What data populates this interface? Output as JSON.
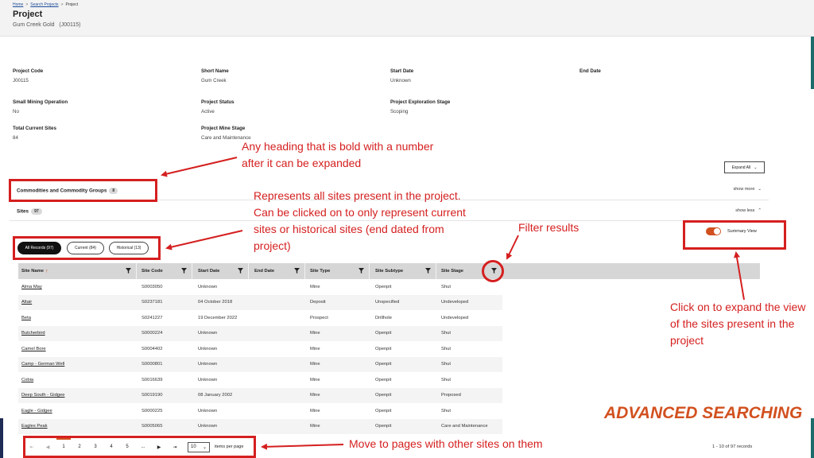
{
  "breadcrumb": {
    "home": "Home",
    "search": "Search Projects",
    "current": "Project"
  },
  "header": {
    "title": "Project",
    "subtitle": "Gum Creek Gold",
    "code": "(J00115)"
  },
  "fields": {
    "project_code": {
      "label": "Project Code",
      "value": "J00115"
    },
    "short_name": {
      "label": "Short Name",
      "value": "Gum Creek"
    },
    "start_date": {
      "label": "Start Date",
      "value": "Unknown"
    },
    "end_date": {
      "label": "End Date",
      "value": ""
    },
    "small_mining": {
      "label": "Small Mining Operation",
      "value": "No"
    },
    "project_status": {
      "label": "Project Status",
      "value": "Active"
    },
    "exploration_stage": {
      "label": "Project Exploration Stage",
      "value": "Scoping"
    },
    "total_sites": {
      "label": "Total Current Sites",
      "value": "84"
    },
    "mine_stage": {
      "label": "Project Mine Stage",
      "value": "Care and Maintenance"
    }
  },
  "expand_all": "Expand All",
  "commodities": {
    "title": "Commodities and Commodity Groups",
    "count": "8",
    "toggle": "show more"
  },
  "sites": {
    "title": "Sites",
    "count": "97",
    "toggle": "show less"
  },
  "filters": {
    "all": "All Records (97)",
    "current": "Current (84)",
    "historical": "Historical (13)"
  },
  "summary_view": "Summary View",
  "table": {
    "columns": [
      "Site Name",
      "Site Code",
      "Start Date",
      "End Date",
      "Site Type",
      "Site Subtype",
      "Site Stage"
    ],
    "rows": [
      [
        "Alma May",
        "S0003050",
        "Unknown",
        "",
        "Mine",
        "Openpit",
        "Shut"
      ],
      [
        "Altair",
        "S0237181",
        "04 October 2018",
        "",
        "Deposit",
        "Unspecified",
        "Undeveloped"
      ],
      [
        "Beta",
        "S0241227",
        "19 December 2022",
        "",
        "Prospect",
        "Drillhole",
        "Undeveloped"
      ],
      [
        "Butcherbird",
        "S0000224",
        "Unknown",
        "",
        "Mine",
        "Openpit",
        "Shut"
      ],
      [
        "Camel Bore",
        "S0004402",
        "Unknown",
        "",
        "Mine",
        "Openpit",
        "Shut"
      ],
      [
        "Camp - German Well",
        "S0000801",
        "Unknown",
        "",
        "Mine",
        "Openpit",
        "Shut"
      ],
      [
        "Cobia",
        "S0016639",
        "Unknown",
        "",
        "Mine",
        "Openpit",
        "Shut"
      ],
      [
        "Deep South - Gidgee",
        "S0019190",
        "08 January 2002",
        "",
        "Mine",
        "Openpit",
        "Proposed"
      ],
      [
        "Eagle - Gidgee",
        "S0000225",
        "Unknown",
        "",
        "Mine",
        "Openpit",
        "Shut"
      ],
      [
        "Eagles Peak",
        "S0005065",
        "Unknown",
        "",
        "Mine",
        "Openpit",
        "Care and Maintenance"
      ]
    ]
  },
  "pager": {
    "pages": [
      "1",
      "2",
      "3",
      "4",
      "5",
      "..."
    ],
    "per_page": "10",
    "per_page_label": "items per page",
    "records": "1 - 10 of 97 records"
  },
  "annotations": {
    "heading_note_1": "Any heading that is bold with a number",
    "heading_note_2": "after it can be expanded",
    "filter_note_1": "Represents all sites present in the project.",
    "filter_note_2": "Can be clicked on to only represent current",
    "filter_note_3": "sites or historical sites (end dated from",
    "filter_note_4": "project)",
    "filter_results": "Filter results",
    "expand_note_1": "Click on to expand the view",
    "expand_note_2": "of the sites present in the",
    "expand_note_3": "project",
    "pages_note": "Move to pages with other sites on them",
    "banner": "ADVANCED SEARCHING"
  },
  "colors": {
    "annotation_red": "#d51f1f",
    "accent_orange": "#d2501f",
    "table_header": "#d6d6d6"
  }
}
